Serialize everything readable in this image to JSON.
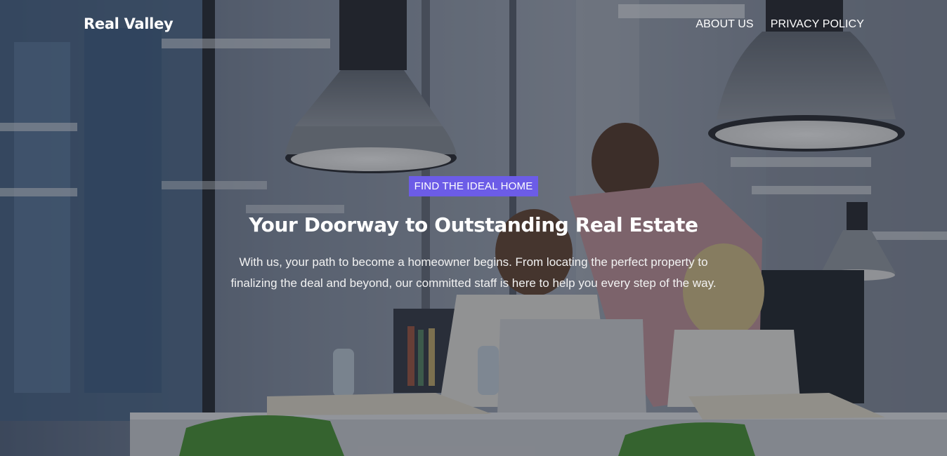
{
  "navbar": {
    "brand": "Real Valley",
    "links": [
      {
        "label": "ABOUT US"
      },
      {
        "label": "PRIVACY POLICY"
      }
    ]
  },
  "hero": {
    "tagline": "FIND THE IDEAL HOME",
    "headline": "Your Doorway to Outstanding Real Estate",
    "description": "With us, your path to become a homeowner begins. From locating the perfect property to finalizing the deal and beyond, our committed staff is here to help you every step of the way."
  },
  "colors": {
    "accent": "#6c5ce7",
    "text": "#ffffff"
  }
}
